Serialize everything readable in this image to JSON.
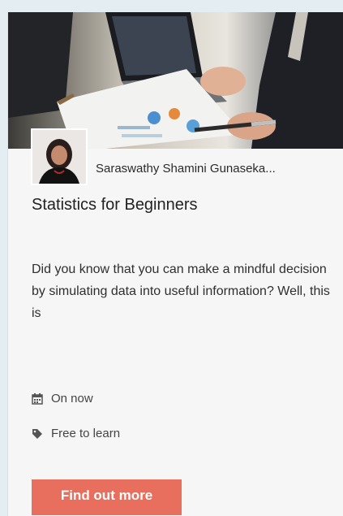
{
  "course": {
    "author": "Saraswathy Shamini Gunaseka...",
    "title": "Statistics for Beginners",
    "description": "Did you know that you can make a mindful decision by simulating data into useful information? Well, this is",
    "status": "On now",
    "price": "Free to learn",
    "cta_label": "Find out more"
  },
  "icons": {
    "status": "calendar-icon",
    "price": "tag-icon"
  },
  "colors": {
    "cta": "#e86f5e",
    "background": "#e4edf2",
    "card": "#f6f6f6"
  }
}
